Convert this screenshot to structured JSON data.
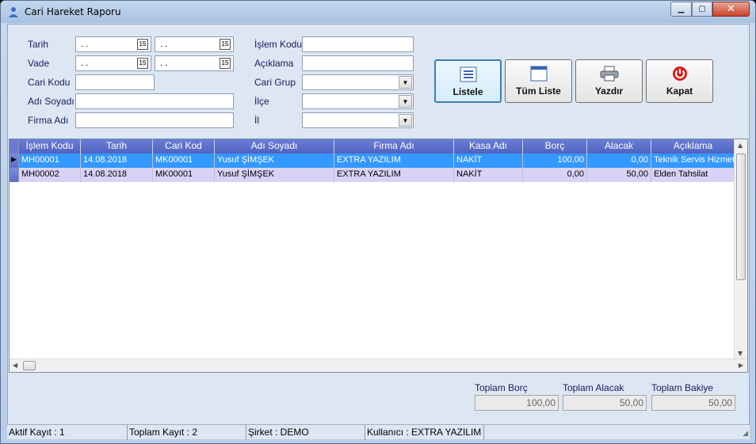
{
  "window": {
    "title": "Cari Hareket Raporu"
  },
  "filters": {
    "tarih_label": "Tarih",
    "vade_label": "Vade",
    "cari_kodu_label": "Cari Kodu",
    "adi_soyadi_label": "Adı Soyadı",
    "firma_adi_label": "Firma Adı",
    "islem_kodu_label": "İşlem Kodu",
    "aciklama_label": "Açıklama",
    "cari_grup_label": "Cari Grup",
    "ilce_label": "İlçe",
    "il_label": "İl",
    "date_empty": ". .",
    "calendar_glyph": "15"
  },
  "buttons": {
    "listele": "Listele",
    "tum_liste": "Tüm Liste",
    "yazdir": "Yazdır",
    "kapat": "Kapat"
  },
  "grid": {
    "columns": [
      "İşlem Kodu",
      "Tarih",
      "Cari Kod",
      "Adı Soyadı",
      "Firma Adı",
      "Kasa Adı",
      "Borç",
      "Alacak",
      "Açıklama"
    ],
    "rows": [
      [
        "MH00001",
        "14.08.2018",
        "MK00001",
        "Yusuf ŞİMŞEK",
        "EXTRA YAZILIM",
        "NAKİT",
        "100,00",
        "0,00",
        "Teknik Servis Hizmeti"
      ],
      [
        "MH00002",
        "14.08.2018",
        "MK00001",
        "Yusuf ŞİMŞEK",
        "EXTRA YAZILIM",
        "NAKİT",
        "0,00",
        "50,00",
        "Elden Tahsilat"
      ]
    ],
    "selected_row": 0
  },
  "totals": {
    "borc_label": "Toplam Borç",
    "borc_value": "100,00",
    "alacak_label": "Toplam Alacak",
    "alacak_value": "50,00",
    "bakiye_label": "Toplam Bakiye",
    "bakiye_value": "50,00"
  },
  "status": {
    "aktif": "Aktif Kayıt : 1",
    "toplam": "Toplam Kayıt : 2",
    "sirket": "Şirket : DEMO",
    "kullanici": "Kullanıcı : EXTRA YAZILIM"
  },
  "colors": {
    "header_blue": "#5163c0",
    "selected_row": "#3399ff",
    "alt_row": "#d7d3f6"
  }
}
